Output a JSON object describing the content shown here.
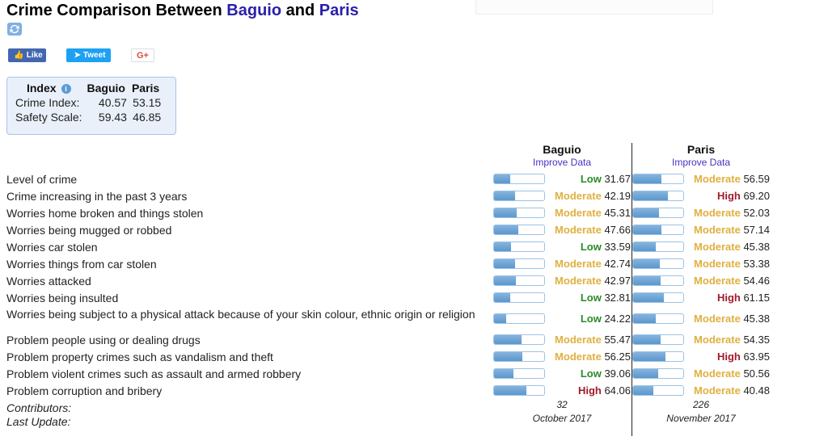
{
  "header": {
    "title_prefix": "Crime Comparison Between ",
    "city1": "Baguio",
    "title_mid": " and ",
    "city2": "Paris"
  },
  "social": {
    "like": "Like",
    "tweet": "Tweet",
    "gplus": "G+"
  },
  "index_box": {
    "header": "Index",
    "col1": "Baguio",
    "col2": "Paris",
    "rows": [
      {
        "label": "Crime Index:",
        "baguio": "40.57",
        "paris": "53.15"
      },
      {
        "label": "Safety Scale:",
        "baguio": "59.43",
        "paris": "46.85"
      }
    ]
  },
  "comparison": {
    "columns": [
      {
        "city": "Baguio",
        "improve": "Improve Data",
        "contributors": "32",
        "last_update": "October 2017"
      },
      {
        "city": "Paris",
        "improve": "Improve Data",
        "contributors": "226",
        "last_update": "November 2017"
      }
    ],
    "contributors_label": "Contributors:",
    "last_update_label": "Last Update:",
    "rows": [
      {
        "label": "Level of crime",
        "baguio": {
          "level": "Low",
          "value": 31.67
        },
        "paris": {
          "level": "Moderate",
          "value": 56.59
        }
      },
      {
        "label": "Crime increasing in the past 3 years",
        "baguio": {
          "level": "Moderate",
          "value": 42.19
        },
        "paris": {
          "level": "High",
          "value": 69.2
        }
      },
      {
        "label": "Worries home broken and things stolen",
        "baguio": {
          "level": "Moderate",
          "value": 45.31
        },
        "paris": {
          "level": "Moderate",
          "value": 52.03
        }
      },
      {
        "label": "Worries being mugged or robbed",
        "baguio": {
          "level": "Moderate",
          "value": 47.66
        },
        "paris": {
          "level": "Moderate",
          "value": 57.14
        }
      },
      {
        "label": "Worries car stolen",
        "baguio": {
          "level": "Low",
          "value": 33.59
        },
        "paris": {
          "level": "Moderate",
          "value": 45.38
        }
      },
      {
        "label": "Worries things from car stolen",
        "baguio": {
          "level": "Moderate",
          "value": 42.74
        },
        "paris": {
          "level": "Moderate",
          "value": 53.38
        }
      },
      {
        "label": "Worries attacked",
        "baguio": {
          "level": "Moderate",
          "value": 42.97
        },
        "paris": {
          "level": "Moderate",
          "value": 54.46
        }
      },
      {
        "label": "Worries being insulted",
        "baguio": {
          "level": "Low",
          "value": 32.81
        },
        "paris": {
          "level": "High",
          "value": 61.15
        }
      },
      {
        "label": "Worries being subject to a physical attack because of your skin colour, ethnic origin or religion",
        "tall": true,
        "baguio": {
          "level": "Low",
          "value": 24.22
        },
        "paris": {
          "level": "Moderate",
          "value": 45.38
        }
      },
      {
        "label": "Problem people using or dealing drugs",
        "baguio": {
          "level": "Moderate",
          "value": 55.47
        },
        "paris": {
          "level": "Moderate",
          "value": 54.35
        }
      },
      {
        "label": "Problem property crimes such as vandalism and theft",
        "baguio": {
          "level": "Moderate",
          "value": 56.25
        },
        "paris": {
          "level": "High",
          "value": 63.95
        }
      },
      {
        "label": "Problem violent crimes such as assault and armed robbery",
        "baguio": {
          "level": "Low",
          "value": 39.06
        },
        "paris": {
          "level": "Moderate",
          "value": 50.56
        }
      },
      {
        "label": "Problem corruption and bribery",
        "baguio": {
          "level": "High",
          "value": 64.06
        },
        "paris": {
          "level": "Moderate",
          "value": 40.48
        }
      }
    ]
  }
}
